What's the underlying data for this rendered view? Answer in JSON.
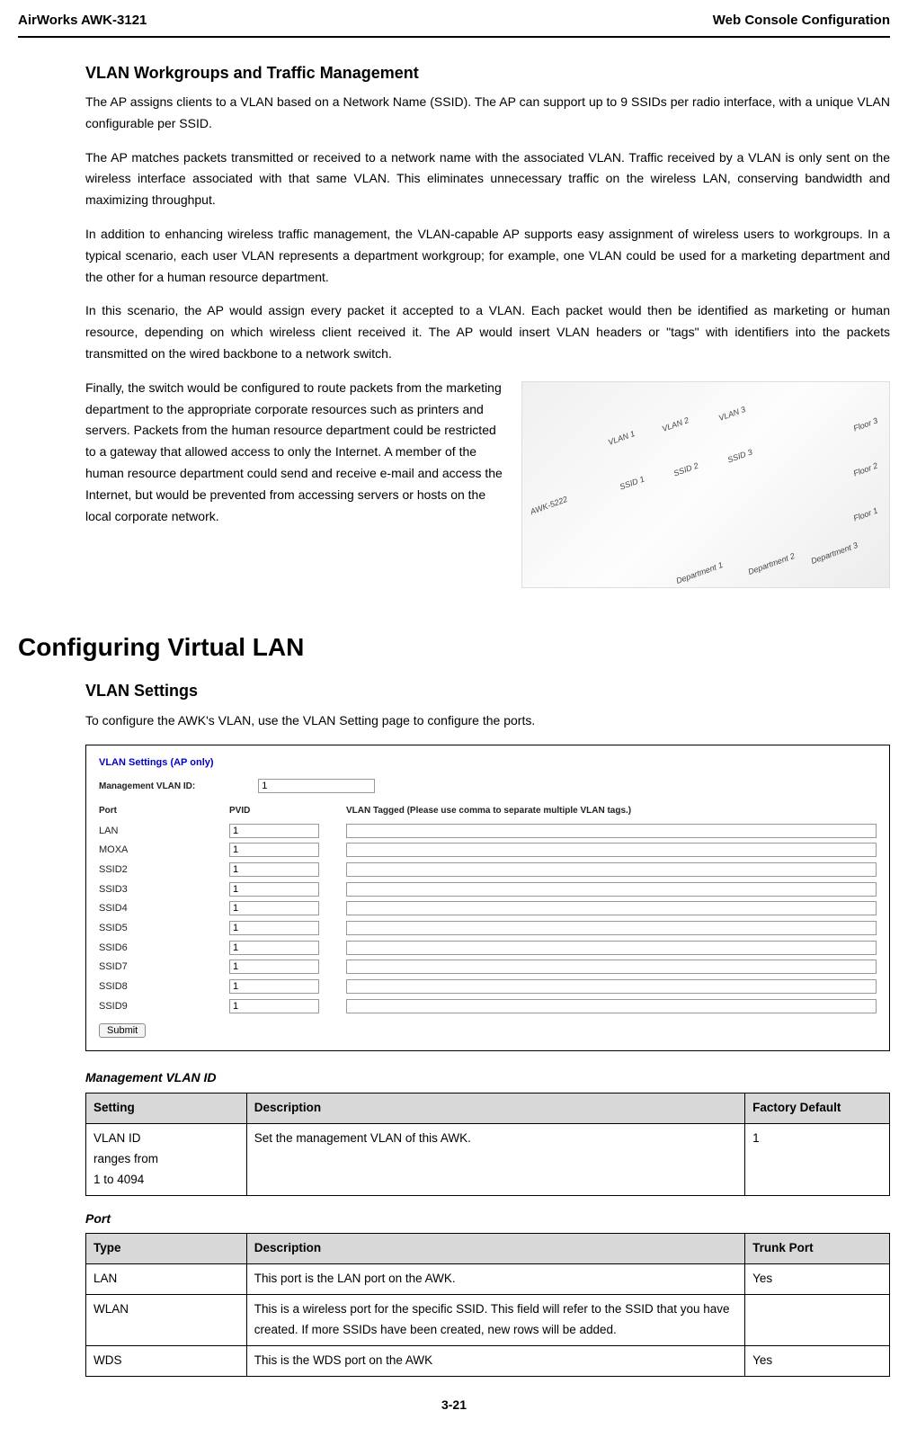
{
  "header": {
    "left": "AirWorks AWK-3121",
    "right": "Web Console Configuration"
  },
  "headings": {
    "h2_workgroups": "VLAN Workgroups and Traffic Management",
    "h1_config": "Configuring Virtual LAN",
    "h2_settings": "VLAN Settings"
  },
  "paragraphs": {
    "p1": "The AP assigns clients to a VLAN based on a Network Name (SSID). The AP can support up to 9 SSIDs per radio interface, with a unique VLAN configurable per SSID.",
    "p2": "The AP matches packets transmitted or received to a network name with the associated VLAN. Traffic received by a VLAN is only sent on the wireless interface associated with that same VLAN. This eliminates unnecessary traffic on the wireless LAN, conserving bandwidth and maximizing throughput.",
    "p3": "In addition to enhancing wireless traffic management, the VLAN-capable AP supports easy assignment of wireless users to workgroups. In a typical scenario, each user VLAN represents a department workgroup; for example, one VLAN could be used for a marketing department and the other for a human resource department.",
    "p4": "In this scenario, the AP would assign every packet it accepted to a VLAN. Each packet would then be identified as marketing or human resource, depending on which wireless client received it. The AP would insert VLAN headers or \"tags\" with identifiers into the packets transmitted on the wired backbone to a network switch.",
    "p5": "Finally, the switch would be configured to route packets from the marketing department to the appropriate corporate resources such as printers and servers. Packets from the human resource department could be restricted to a gateway that allowed access to only the Internet. A member of the human resource department could send and receive e-mail and access the Internet, but would be prevented from accessing servers or hosts on the local corporate network.",
    "p_settings": "To configure the AWK's VLAN, use the VLAN Setting page to configure the ports."
  },
  "diagram": {
    "device": "AWK-5222",
    "vlans": [
      "VLAN 1",
      "VLAN 2",
      "VLAN 3"
    ],
    "ssids": [
      "SSID 1",
      "SSID 2",
      "SSID 3"
    ],
    "floors": [
      "Floor 3",
      "Floor 2",
      "Floor 1"
    ],
    "depts": [
      "Department 1",
      "Department 2",
      "Department 3"
    ]
  },
  "screenshot": {
    "title": "VLAN Settings (AP only)",
    "mgmt_label": "Management VLAN ID:",
    "mgmt_value": "1",
    "headers": {
      "port": "Port",
      "pvid": "PVID",
      "tagged": "VLAN Tagged (Please use comma to separate multiple VLAN tags.)"
    },
    "rows": [
      {
        "port": "LAN",
        "pvid": "1",
        "tag": ""
      },
      {
        "port": "MOXA",
        "pvid": "1",
        "tag": ""
      },
      {
        "port": "SSID2",
        "pvid": "1",
        "tag": ""
      },
      {
        "port": "SSID3",
        "pvid": "1",
        "tag": ""
      },
      {
        "port": "SSID4",
        "pvid": "1",
        "tag": ""
      },
      {
        "port": "SSID5",
        "pvid": "1",
        "tag": ""
      },
      {
        "port": "SSID6",
        "pvid": "1",
        "tag": ""
      },
      {
        "port": "SSID7",
        "pvid": "1",
        "tag": ""
      },
      {
        "port": "SSID8",
        "pvid": "1",
        "tag": ""
      },
      {
        "port": "SSID9",
        "pvid": "1",
        "tag": ""
      }
    ],
    "submit": "Submit"
  },
  "table1": {
    "caption": "Management VLAN ID",
    "headers": [
      "Setting",
      "Description",
      "Factory Default"
    ],
    "rows": [
      {
        "c0": "VLAN ID\nranges from\n1 to 4094",
        "c1": "Set the management VLAN of this AWK.",
        "c2": "1"
      }
    ]
  },
  "table2": {
    "caption": "Port",
    "headers": [
      "Type",
      "Description",
      "Trunk Port"
    ],
    "rows": [
      {
        "c0": "LAN",
        "c1": "This port is the LAN port on the AWK.",
        "c2": "Yes"
      },
      {
        "c0": "WLAN",
        "c1": "This is a wireless port for the specific SSID. This field will refer to the SSID that you have created. If more SSIDs have been created, new rows will be added.",
        "c2": ""
      },
      {
        "c0": "WDS",
        "c1": "This is the WDS port on the AWK",
        "c2": "Yes"
      }
    ]
  },
  "footer": {
    "page": "3-21"
  }
}
